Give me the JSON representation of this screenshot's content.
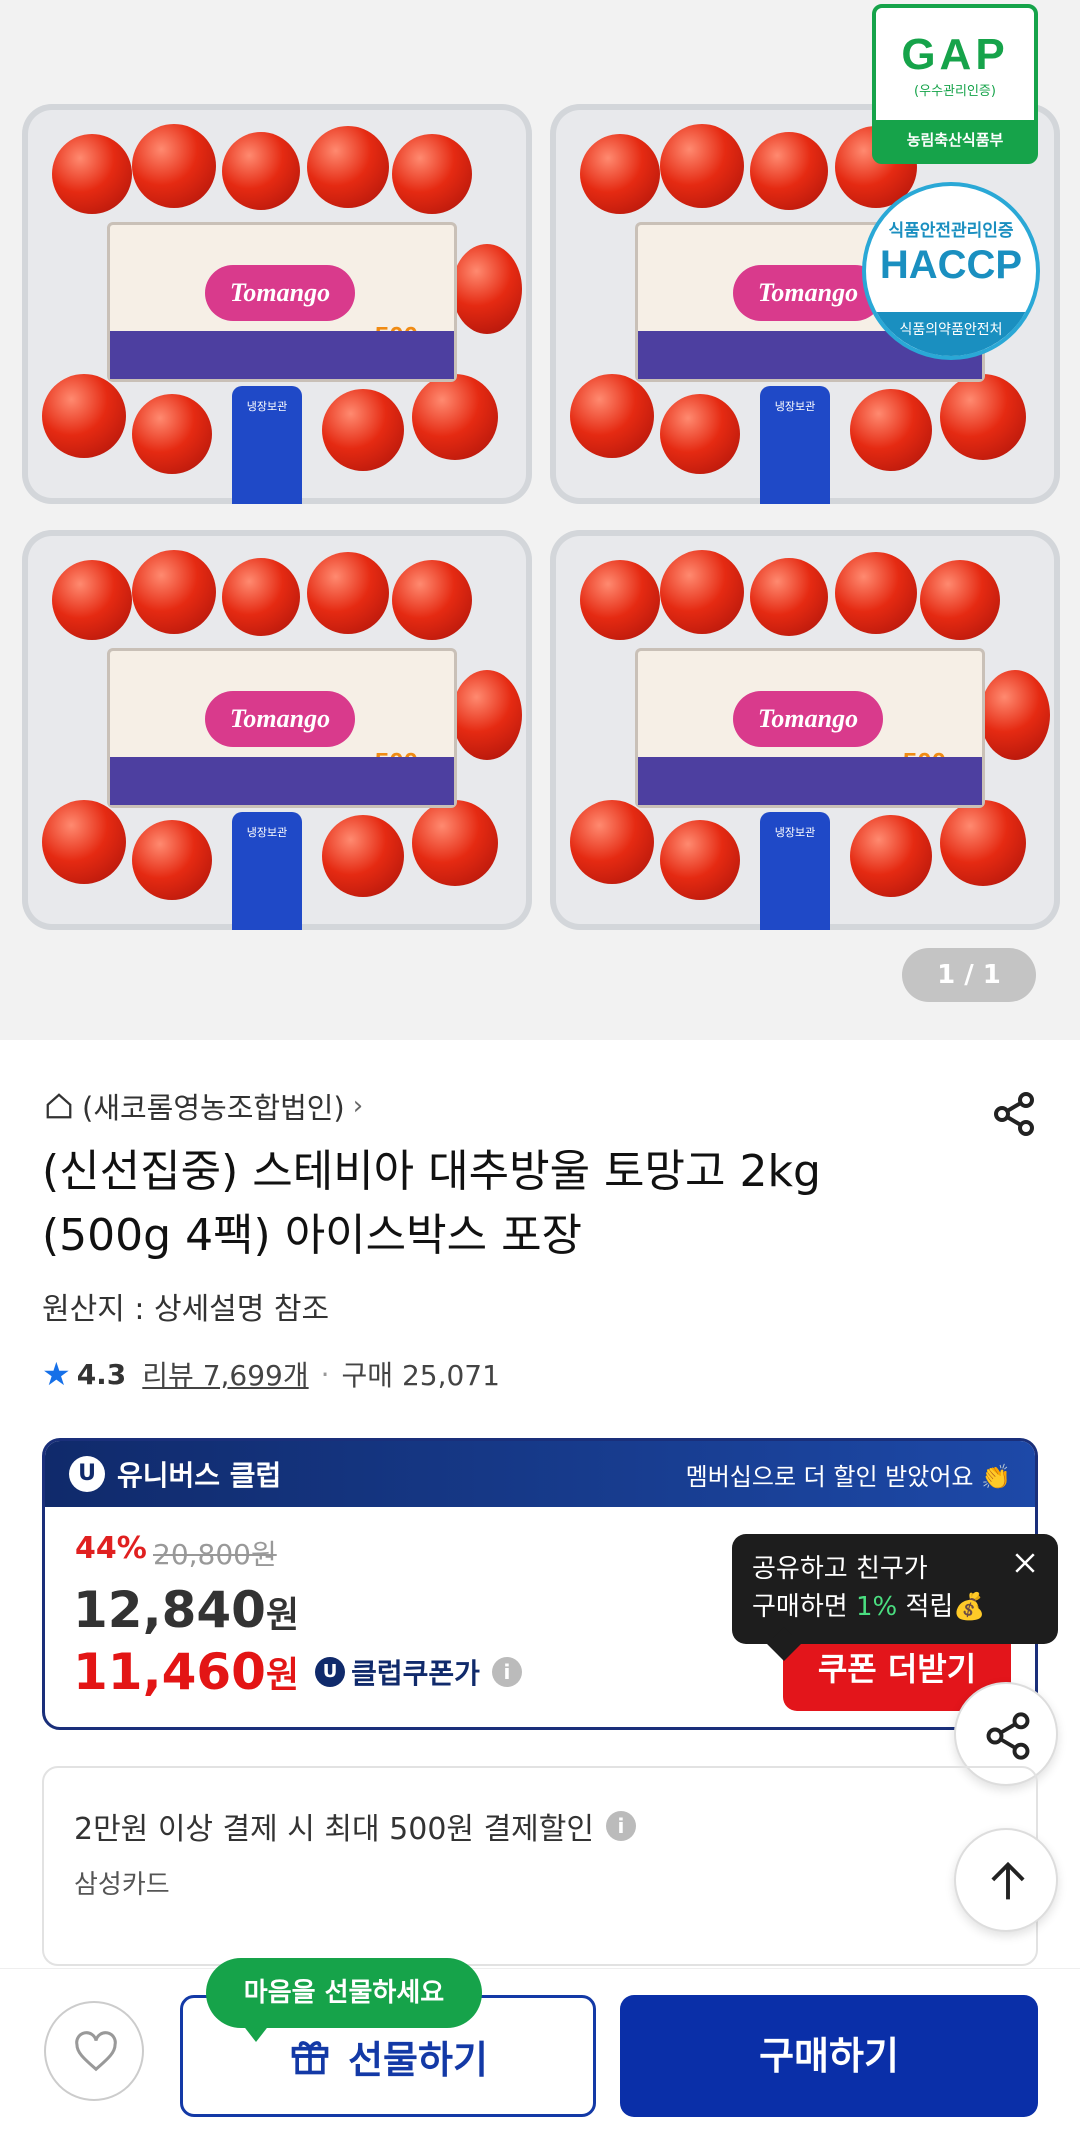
{
  "gallery": {
    "counter": "1 / 1",
    "gap_badge": {
      "title": "GAP",
      "sub": "(우수관리인증)",
      "ministry": "농림축산식품부"
    },
    "haccp_badge": {
      "top": "식품안전관리인증",
      "mark": "HACCP",
      "bottom": "식품의약품안전처"
    },
    "pack_brand": "Tomango",
    "pack_weight": "500g",
    "pack_tab": "냉장보관"
  },
  "seller": {
    "name": "(새코롬영농조합법인)"
  },
  "product": {
    "title": "(신선집중) 스테비아 대추방울 토망고 2kg (500g 4팩) 아이스박스 포장",
    "origin": "원산지 : 상세설명 참조",
    "rating": "4.3",
    "reviews": "리뷰 7,699개",
    "purchases": "구매 25,071"
  },
  "club": {
    "name": "유니버스 클럽",
    "message": "멤버십으로 더 할인 받았어요 👏",
    "discount": "44%",
    "original_price": "20,800원",
    "price": "12,840",
    "price_unit": "원",
    "coupon_price": "11,460",
    "coupon_unit": "원",
    "coupon_label": "클럽쿠폰가",
    "coupon_button": "쿠폰 더받기"
  },
  "tooltip": {
    "line1": "공유하고 친구가",
    "line2_pre": "구매하면 ",
    "line2_pct": "1%",
    "line2_post": " 적립💰"
  },
  "payment": {
    "title": "2만원 이상 결제 시 최대 500원 결제할인",
    "card": "삼성카드"
  },
  "bottom": {
    "gift_bubble": "마음을 선물하세요",
    "gift_label": "선물하기",
    "buy_label": "구매하기"
  }
}
